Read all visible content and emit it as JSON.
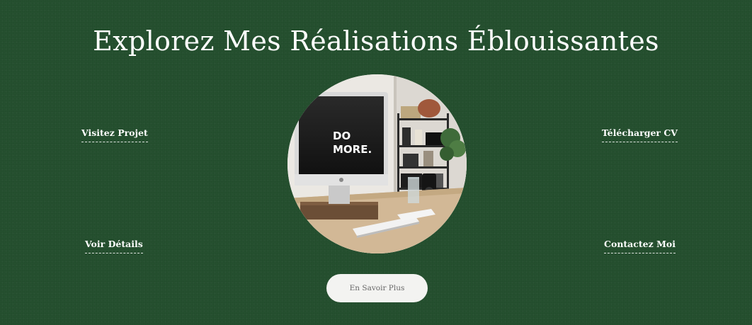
{
  "page": {
    "title": "Explorez Mes Réalisations Éblouissantes"
  },
  "links": {
    "top_left": "Visitez Projet",
    "bottom_left": "Voir Détails",
    "top_right": "Télécharger CV",
    "bottom_right": "Contactez Moi"
  },
  "photo": {
    "screen_text_line1": "DO",
    "screen_text_line2": "MORE."
  },
  "cta": {
    "label": "En Savoir Plus"
  },
  "colors": {
    "background": "#25502f",
    "text": "#ffffff",
    "button_bg": "#f3f3f1",
    "button_text": "#666666"
  }
}
